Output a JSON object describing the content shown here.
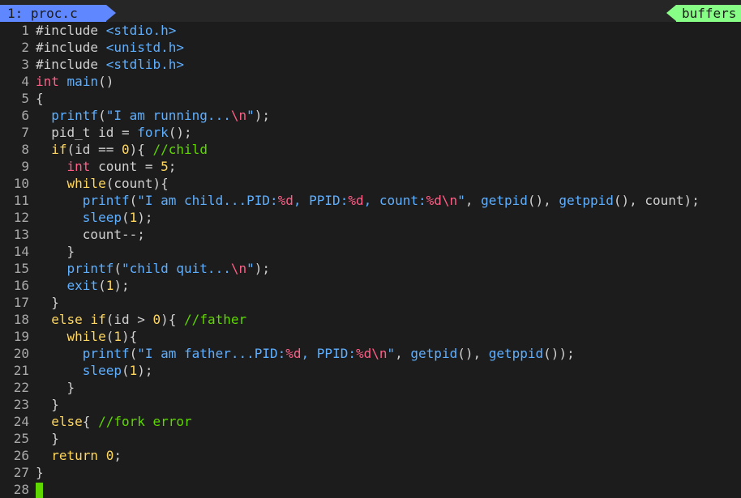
{
  "tabline": {
    "active_tab": "1: proc.c",
    "buffers_label": "buffers"
  },
  "editor": {
    "lines": [
      {
        "n": "1",
        "tokens": [
          {
            "c": "pre",
            "t": "#include "
          },
          {
            "c": "inc",
            "t": "<stdio.h>"
          }
        ]
      },
      {
        "n": "2",
        "tokens": [
          {
            "c": "pre",
            "t": "#include "
          },
          {
            "c": "inc",
            "t": "<unistd.h>"
          }
        ]
      },
      {
        "n": "3",
        "tokens": [
          {
            "c": "pre",
            "t": "#include "
          },
          {
            "c": "inc",
            "t": "<stdlib.h>"
          }
        ]
      },
      {
        "n": "4",
        "tokens": [
          {
            "c": "type",
            "t": "int"
          },
          {
            "c": "id",
            "t": " "
          },
          {
            "c": "fn",
            "t": "main"
          },
          {
            "c": "punc",
            "t": "()"
          }
        ]
      },
      {
        "n": "5",
        "tokens": [
          {
            "c": "punc",
            "t": "{"
          }
        ]
      },
      {
        "n": "6",
        "tokens": [
          {
            "c": "id",
            "t": "  "
          },
          {
            "c": "fn",
            "t": "printf"
          },
          {
            "c": "punc",
            "t": "("
          },
          {
            "c": "str",
            "t": "\"I am running..."
          },
          {
            "c": "esc",
            "t": "\\n"
          },
          {
            "c": "str",
            "t": "\""
          },
          {
            "c": "punc",
            "t": ");"
          }
        ]
      },
      {
        "n": "7",
        "tokens": [
          {
            "c": "id",
            "t": "  pid_t id = "
          },
          {
            "c": "fn",
            "t": "fork"
          },
          {
            "c": "punc",
            "t": "();"
          }
        ]
      },
      {
        "n": "8",
        "tokens": [
          {
            "c": "id",
            "t": "  "
          },
          {
            "c": "kw",
            "t": "if"
          },
          {
            "c": "punc",
            "t": "(id == "
          },
          {
            "c": "num",
            "t": "0"
          },
          {
            "c": "punc",
            "t": "){ "
          },
          {
            "c": "cmt",
            "t": "//child"
          }
        ]
      },
      {
        "n": "9",
        "tokens": [
          {
            "c": "id",
            "t": "    "
          },
          {
            "c": "type",
            "t": "int"
          },
          {
            "c": "id",
            "t": " count = "
          },
          {
            "c": "num",
            "t": "5"
          },
          {
            "c": "punc",
            "t": ";"
          }
        ]
      },
      {
        "n": "10",
        "tokens": [
          {
            "c": "id",
            "t": "    "
          },
          {
            "c": "kw",
            "t": "while"
          },
          {
            "c": "punc",
            "t": "(count){"
          }
        ]
      },
      {
        "n": "11",
        "tokens": [
          {
            "c": "id",
            "t": "      "
          },
          {
            "c": "fn",
            "t": "printf"
          },
          {
            "c": "punc",
            "t": "("
          },
          {
            "c": "str",
            "t": "\"I am child...PID:"
          },
          {
            "c": "esc",
            "t": "%d"
          },
          {
            "c": "str",
            "t": ", PPID:"
          },
          {
            "c": "esc",
            "t": "%d"
          },
          {
            "c": "str",
            "t": ", count:"
          },
          {
            "c": "esc",
            "t": "%d\\n"
          },
          {
            "c": "str",
            "t": "\""
          },
          {
            "c": "punc",
            "t": ", "
          },
          {
            "c": "fn",
            "t": "getpid"
          },
          {
            "c": "punc",
            "t": "(), "
          },
          {
            "c": "fn",
            "t": "getppid"
          },
          {
            "c": "punc",
            "t": "(), count);"
          }
        ]
      },
      {
        "n": "12",
        "tokens": [
          {
            "c": "id",
            "t": "      "
          },
          {
            "c": "fn",
            "t": "sleep"
          },
          {
            "c": "punc",
            "t": "("
          },
          {
            "c": "num",
            "t": "1"
          },
          {
            "c": "punc",
            "t": ");"
          }
        ]
      },
      {
        "n": "13",
        "tokens": [
          {
            "c": "id",
            "t": "      count--;"
          }
        ]
      },
      {
        "n": "14",
        "tokens": [
          {
            "c": "id",
            "t": "    }"
          }
        ]
      },
      {
        "n": "15",
        "tokens": [
          {
            "c": "id",
            "t": "    "
          },
          {
            "c": "fn",
            "t": "printf"
          },
          {
            "c": "punc",
            "t": "("
          },
          {
            "c": "str",
            "t": "\"child quit..."
          },
          {
            "c": "esc",
            "t": "\\n"
          },
          {
            "c": "str",
            "t": "\""
          },
          {
            "c": "punc",
            "t": ");"
          }
        ]
      },
      {
        "n": "16",
        "tokens": [
          {
            "c": "id",
            "t": "    "
          },
          {
            "c": "fn",
            "t": "exit"
          },
          {
            "c": "punc",
            "t": "("
          },
          {
            "c": "num",
            "t": "1"
          },
          {
            "c": "punc",
            "t": ");"
          }
        ]
      },
      {
        "n": "17",
        "tokens": [
          {
            "c": "id",
            "t": "  }"
          }
        ]
      },
      {
        "n": "18",
        "tokens": [
          {
            "c": "id",
            "t": "  "
          },
          {
            "c": "kw",
            "t": "else"
          },
          {
            "c": "id",
            "t": " "
          },
          {
            "c": "kw",
            "t": "if"
          },
          {
            "c": "punc",
            "t": "(id > "
          },
          {
            "c": "num",
            "t": "0"
          },
          {
            "c": "punc",
            "t": "){ "
          },
          {
            "c": "cmt",
            "t": "//father"
          }
        ]
      },
      {
        "n": "19",
        "tokens": [
          {
            "c": "id",
            "t": "    "
          },
          {
            "c": "kw",
            "t": "while"
          },
          {
            "c": "punc",
            "t": "("
          },
          {
            "c": "num",
            "t": "1"
          },
          {
            "c": "punc",
            "t": "){"
          }
        ]
      },
      {
        "n": "20",
        "tokens": [
          {
            "c": "id",
            "t": "      "
          },
          {
            "c": "fn",
            "t": "printf"
          },
          {
            "c": "punc",
            "t": "("
          },
          {
            "c": "str",
            "t": "\"I am father...PID:"
          },
          {
            "c": "esc",
            "t": "%d"
          },
          {
            "c": "str",
            "t": ", PPID:"
          },
          {
            "c": "esc",
            "t": "%d\\n"
          },
          {
            "c": "str",
            "t": "\""
          },
          {
            "c": "punc",
            "t": ", "
          },
          {
            "c": "fn",
            "t": "getpid"
          },
          {
            "c": "punc",
            "t": "(), "
          },
          {
            "c": "fn",
            "t": "getppid"
          },
          {
            "c": "punc",
            "t": "());"
          }
        ]
      },
      {
        "n": "21",
        "tokens": [
          {
            "c": "id",
            "t": "      "
          },
          {
            "c": "fn",
            "t": "sleep"
          },
          {
            "c": "punc",
            "t": "("
          },
          {
            "c": "num",
            "t": "1"
          },
          {
            "c": "punc",
            "t": ");"
          }
        ]
      },
      {
        "n": "22",
        "tokens": [
          {
            "c": "id",
            "t": "    }"
          }
        ]
      },
      {
        "n": "23",
        "tokens": [
          {
            "c": "id",
            "t": "  }"
          }
        ]
      },
      {
        "n": "24",
        "tokens": [
          {
            "c": "id",
            "t": "  "
          },
          {
            "c": "kw",
            "t": "else"
          },
          {
            "c": "punc",
            "t": "{ "
          },
          {
            "c": "cmt",
            "t": "//fork error"
          }
        ]
      },
      {
        "n": "25",
        "tokens": [
          {
            "c": "id",
            "t": "  }"
          }
        ]
      },
      {
        "n": "26",
        "tokens": [
          {
            "c": "id",
            "t": "  "
          },
          {
            "c": "kw",
            "t": "return"
          },
          {
            "c": "id",
            "t": " "
          },
          {
            "c": "num",
            "t": "0"
          },
          {
            "c": "punc",
            "t": ";"
          }
        ]
      },
      {
        "n": "27",
        "tokens": [
          {
            "c": "punc",
            "t": "}"
          }
        ]
      },
      {
        "n": "28",
        "tokens": [],
        "cursor": true
      }
    ]
  },
  "colors": {
    "background": "#1c1c1c",
    "tab_active": "#5f87ff",
    "buffers_tab": "#87ff87",
    "line_number": "#a8a8a8",
    "keyword_type": "#ff5f87",
    "keyword_control": "#ffd75f",
    "function": "#5fafff",
    "comment": "#5fd700",
    "cursor": "#5fd700"
  }
}
